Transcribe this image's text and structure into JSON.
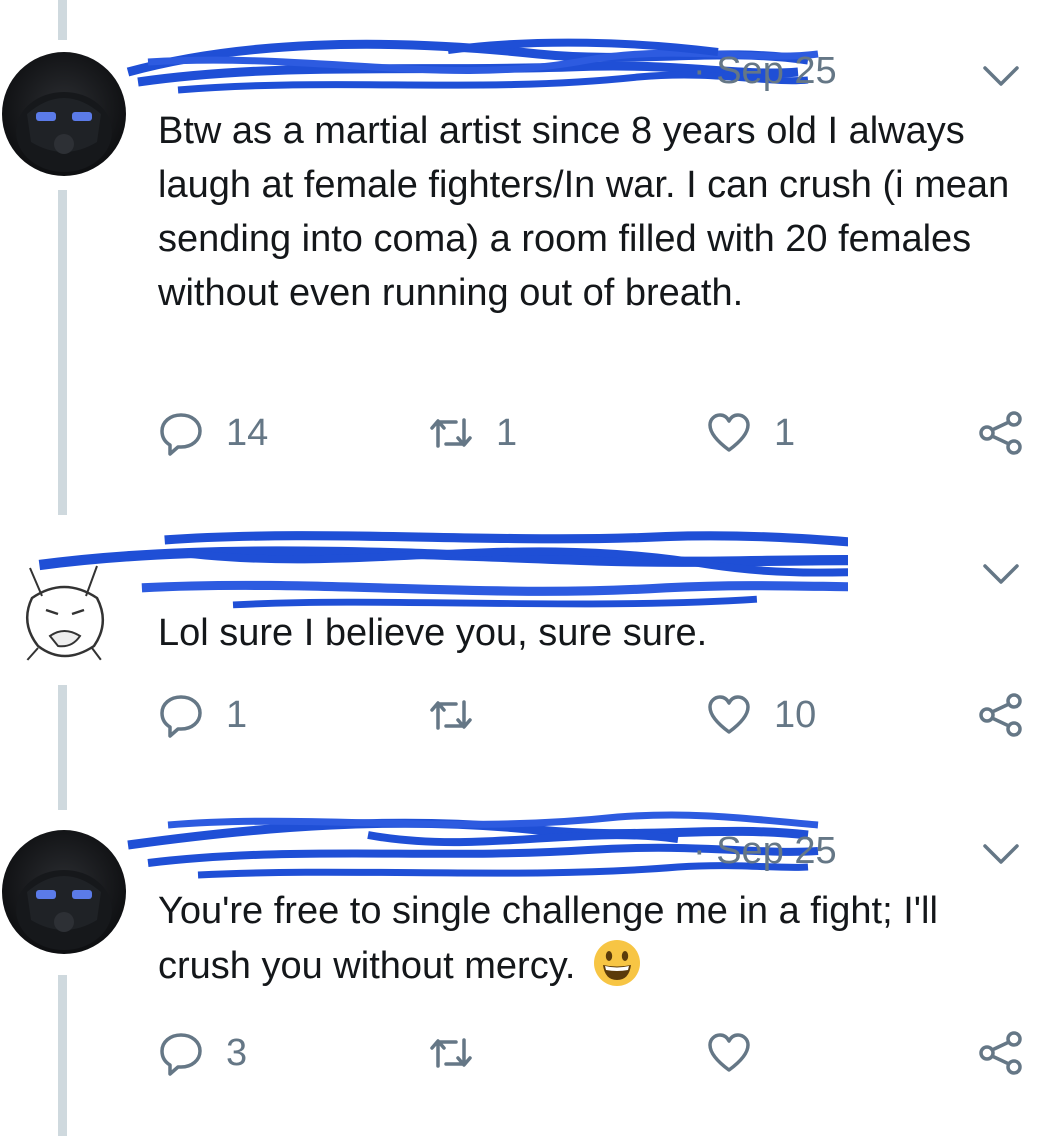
{
  "thread": {
    "tweets": [
      {
        "date": "· Sep 25",
        "text": "Btw as a martial artist since 8 years old I always laugh at female fighters/In war. I can crush (i mean sending into coma) a room filled with 20 females without even running out of breath.",
        "replies": "14",
        "retweets": "1",
        "likes": "1",
        "avatar": "dark-masked-avatar"
      },
      {
        "date": "",
        "text": "Lol sure I believe you, sure sure.",
        "replies": "1",
        "retweets": "",
        "likes": "10",
        "avatar": "cartoon-cat-sketch-avatar"
      },
      {
        "date": "· Sep 25",
        "text": "You're free to single challenge me in a fight; I'll crush you without mercy.",
        "emoji": "grinning-face",
        "replies": "3",
        "retweets": "",
        "likes": "",
        "avatar": "dark-masked-avatar"
      }
    ]
  },
  "colors": {
    "redaction": "#1f4fd6",
    "muted": "#657786",
    "thread_line": "#cfd9de",
    "emoji": "#f7c544"
  },
  "icons": [
    "reply-icon",
    "retweet-icon",
    "like-icon",
    "share-icon",
    "chevron-down-icon"
  ]
}
